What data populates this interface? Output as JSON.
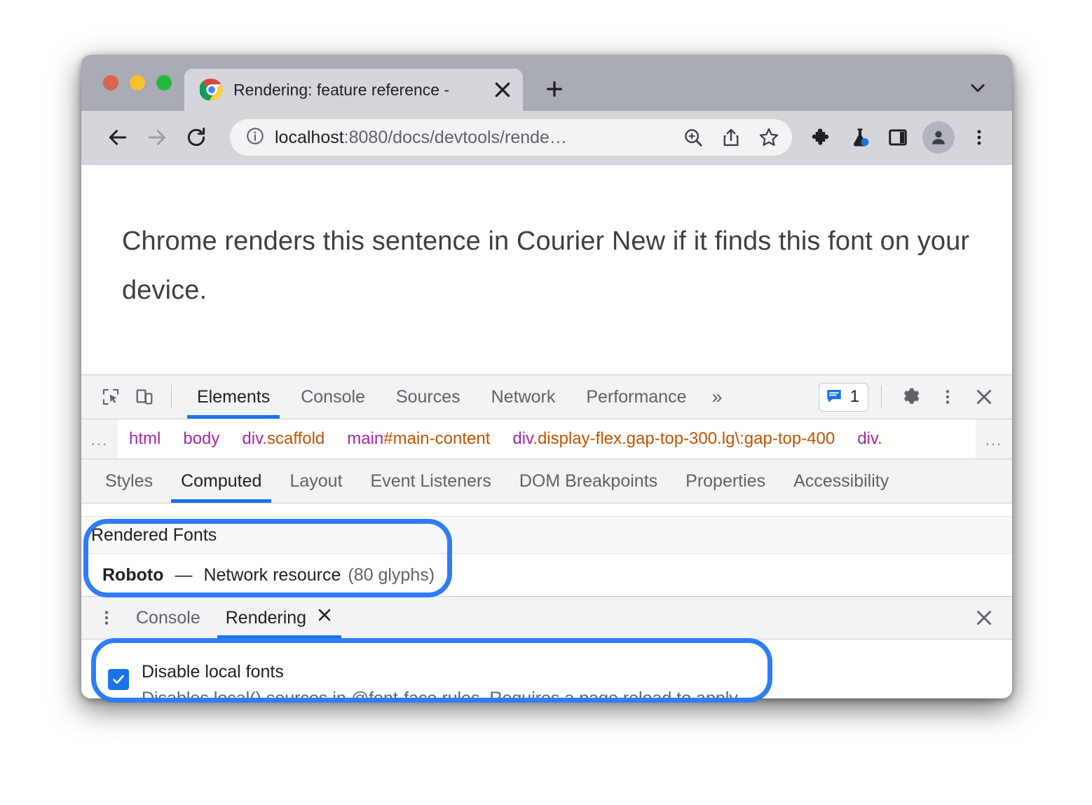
{
  "window": {
    "traffic_lights": [
      "close",
      "minimize",
      "maximize"
    ]
  },
  "tabstrip": {
    "tab_title": "Rendering: feature reference - ",
    "favicon": "chrome-logo-icon",
    "close_label": "×",
    "new_tab_label": "+",
    "tab_search_label": "⌄"
  },
  "toolbar": {
    "back": "back-arrow",
    "forward": "forward-arrow",
    "reload": "reload",
    "omnibox": {
      "info_icon": "info-circle",
      "url_host": "localhost",
      "url_rest": ":8080/docs/devtools/rende…",
      "zoom_icon": "zoom-in",
      "share_icon": "share",
      "bookmark_icon": "star"
    },
    "extensions_icon": "puzzle",
    "experiment_icon": "flask",
    "side_panel_icon": "side-panel",
    "profile_icon": "person",
    "menu_icon": "three-dot-menu"
  },
  "page": {
    "sentence": "Chrome renders this sentence in Courier New if it finds this font on your device."
  },
  "devtools": {
    "inspect_icon": "inspect-cursor",
    "device_icon": "device-toolbar",
    "tabs": [
      {
        "label": "Elements",
        "active": true
      },
      {
        "label": "Console",
        "active": false
      },
      {
        "label": "Sources",
        "active": false
      },
      {
        "label": "Network",
        "active": false
      },
      {
        "label": "Performance",
        "active": false
      }
    ],
    "more_tabs_label": "»",
    "message_count": "1",
    "message_icon": "chat-bubble",
    "settings_icon": "gear",
    "customize_icon": "three-dot-menu",
    "close_icon": "close",
    "breadcrumb": {
      "left_ellipsis": "…",
      "right_ellipsis": "…",
      "items": [
        {
          "tag": "html",
          "suffix": ""
        },
        {
          "tag": "body",
          "suffix": ""
        },
        {
          "tag": "div",
          "suffix": ".scaffold"
        },
        {
          "tag": "main",
          "suffix": "#main-content"
        },
        {
          "tag": "div",
          "suffix": ".display-flex.gap-top-300.lg\\:gap-top-400"
        },
        {
          "tag": "div",
          "suffix": "."
        }
      ]
    },
    "subtabs": [
      {
        "label": "Styles",
        "active": false
      },
      {
        "label": "Computed",
        "active": true
      },
      {
        "label": "Layout",
        "active": false
      },
      {
        "label": "Event Listeners",
        "active": false
      },
      {
        "label": "DOM Breakpoints",
        "active": false
      },
      {
        "label": "Properties",
        "active": false
      },
      {
        "label": "Accessibility",
        "active": false
      }
    ],
    "rendered_fonts": {
      "section_title": "Rendered Fonts",
      "font_name": "Roboto",
      "dash": "—",
      "source": "Network resource",
      "glyphs": "(80 glyphs)"
    },
    "drawer": {
      "menu_icon": "three-dot-menu",
      "tabs": [
        {
          "label": "Console",
          "active": false,
          "closable": false
        },
        {
          "label": "Rendering",
          "active": true,
          "closable": true
        }
      ],
      "close_tab_label": "×",
      "close_drawer_label": "×",
      "settings": [
        {
          "title": "Disable local fonts",
          "description": "Disables local() sources in @font-face rules. Requires a page reload to apply.",
          "checked": true
        }
      ]
    }
  },
  "annotations": {
    "highlight_color": "#2e7df6",
    "rings": [
      "rendered-fonts-highlight",
      "disable-local-fonts-highlight"
    ]
  }
}
